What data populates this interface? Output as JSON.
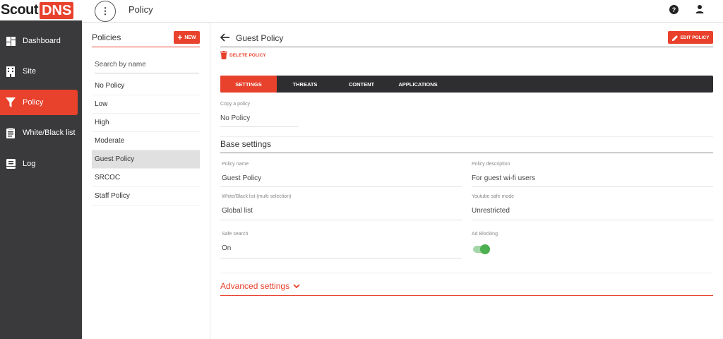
{
  "app": {
    "logo_part1": "Scout",
    "logo_part2": "DNS",
    "page_title": "Policy"
  },
  "sidebar": {
    "items": [
      {
        "label": "Dashboard",
        "icon": "dashboard-icon"
      },
      {
        "label": "Site",
        "icon": "building-icon"
      },
      {
        "label": "Policy",
        "icon": "filter-icon",
        "active": true
      },
      {
        "label": "White/Black list",
        "icon": "clipboard-icon"
      },
      {
        "label": "Log",
        "icon": "book-icon"
      }
    ]
  },
  "policies": {
    "title": "Policies",
    "new_label": "NEW",
    "search_placeholder": "Search by name",
    "items": [
      "No Policy",
      "Low",
      "High",
      "Moderate",
      "Guest Policy",
      "SRCOC",
      "Staff Policy"
    ],
    "selected": "Guest Policy"
  },
  "main": {
    "title": "Guest Policy",
    "edit_label": "EDIT POLICY",
    "delete_label": "DELETE POLICY",
    "tabs": [
      "SETTINGS",
      "THREATS",
      "CONTENT",
      "APPLICATIONS"
    ],
    "active_tab": "SETTINGS",
    "copy_label": "Copy a policy",
    "copy_value": "No Policy",
    "base_settings_title": "Base settings",
    "fields": {
      "policy_name_label": "Policy name",
      "policy_name_value": "Guest Policy",
      "policy_desc_label": "Policy description",
      "policy_desc_value": "For guest wi-fi users",
      "wbl_label": "White/Black list (multi selection)",
      "wbl_value": "Global list",
      "youtube_label": "Youtube safe mode",
      "youtube_value": "Unrestricted",
      "safe_search_label": "Safe search",
      "safe_search_value": "On",
      "ad_blocking_label": "Ad Blocking",
      "ad_blocking_on": true
    },
    "advanced_label": "Advanced settings"
  },
  "colors": {
    "accent": "#e8412c",
    "sidebar_bg": "#3a3a3c",
    "toggle_on": "#4caf50"
  }
}
